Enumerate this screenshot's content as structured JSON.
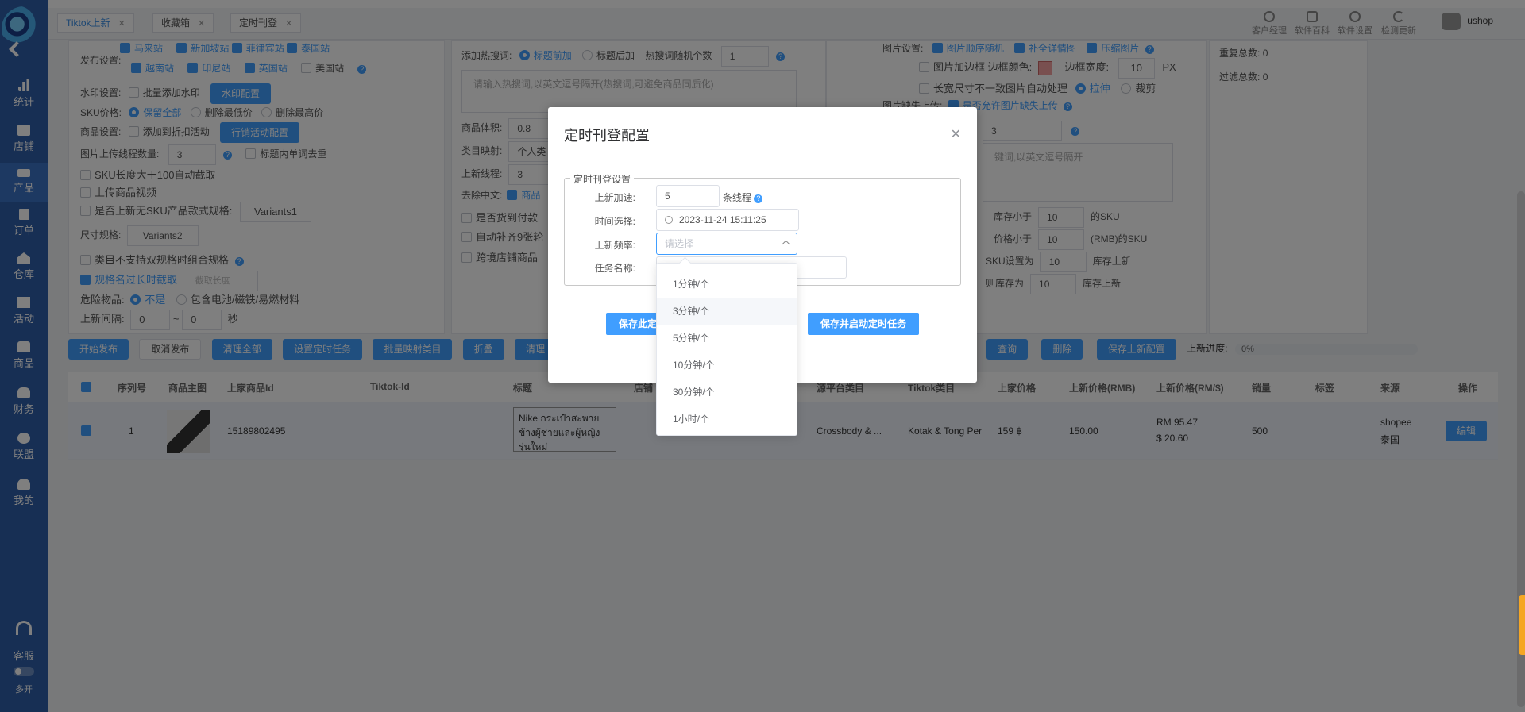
{
  "sidebar": {
    "items": [
      {
        "label": "统计",
        "icon": "bar-chart-icon"
      },
      {
        "label": "店铺",
        "icon": "store-icon"
      },
      {
        "label": "产品",
        "icon": "product-icon"
      },
      {
        "label": "订单",
        "icon": "order-icon"
      },
      {
        "label": "仓库",
        "icon": "warehouse-icon"
      },
      {
        "label": "活动",
        "icon": "gift-icon"
      },
      {
        "label": "商品",
        "icon": "goods-icon"
      },
      {
        "label": "财务",
        "icon": "finance-icon"
      },
      {
        "label": "联盟",
        "icon": "alliance-icon"
      },
      {
        "label": "我的",
        "icon": "user-icon"
      }
    ],
    "service_label": "客服",
    "multi_label": "多开"
  },
  "tabs": [
    {
      "label": "Tiktok上新"
    },
    {
      "label": "收藏箱"
    },
    {
      "label": "定时刊登"
    }
  ],
  "toolbar": {
    "items": [
      {
        "label": "客户经理",
        "icon": "person-icon"
      },
      {
        "label": "软件百科",
        "icon": "book-icon"
      },
      {
        "label": "软件设置",
        "icon": "gear-icon"
      },
      {
        "label": "检测更新",
        "icon": "refresh-icon"
      }
    ],
    "username": "ushop"
  },
  "settings": {
    "publish_label": "发布设置:",
    "sites": [
      "马来站",
      "新加坡站",
      "菲律宾站",
      "泰国站",
      "越南站",
      "印尼站",
      "英国站",
      "美国站"
    ],
    "watermark_label": "水印设置:",
    "watermark_batch": "批量添加水印",
    "watermark_btn": "水印配置",
    "sku_price_label": "SKU价格:",
    "sku_keep_all": "保留全部",
    "sku_del_min": "删除最低价",
    "sku_del_max": "删除最高价",
    "goods_label": "商品设置:",
    "goods_discount": "添加到折扣活动",
    "promo_btn": "行销活动配置",
    "img_threads_label": "图片上传线程数量:",
    "img_threads_value": "3",
    "title_dedup": "标题内单词去重",
    "sku_len": "SKU长度大于100自动截取",
    "upload_video": "上传商品视频",
    "no_sku_label": "是否上新无SKU产品款式规格:",
    "no_sku_value": "Variants1",
    "size_label": "尺寸规格:",
    "size_value": "Variants2",
    "cat_combo": "类目不支持双规格时组合规格",
    "spec_truncate": "规格名过长时截取",
    "spec_truncate_placeholder": "截取长度",
    "danger_label": "危险物品:",
    "danger_no": "不是",
    "danger_yes": "包含电池/磁铁/易燃材料",
    "interval_label": "上新间隔:",
    "interval_from": "0",
    "interval_to": "0",
    "interval_unit": "秒",
    "hot_label": "添加热搜词:",
    "hot_front": "标题前加",
    "hot_back": "标题后加",
    "hot_count_label": "热搜词随机个数",
    "hot_count_value": "1",
    "hot_placeholder": "请输入热搜词,以英文逗号隔开(热搜词,可避免商品同质化)",
    "volume_label": "商品体积:",
    "volume_value": "0.8",
    "cat_map_label": "类目映射:",
    "cat_map_value": "个人类",
    "threads_label": "上新线程:",
    "threads_value": "3",
    "remove_cn_label": "去除中文:",
    "remove_cn_value": "商品",
    "cod_label": "是否货到付款",
    "auto_fill_label": "自动补齐9张轮",
    "cross_label": "跨境店铺商品",
    "img_settings_label": "图片设置:",
    "img_random": "图片顺序随机",
    "img_detail": "补全详情图",
    "img_compress": "压缩图片",
    "img_border": "图片加边框 边框颜色:",
    "border_width_label": "边框宽度:",
    "border_width_value": "10",
    "border_width_unit": "PX",
    "aspect_label": "长宽尺寸不一致图片自动处理",
    "aspect_stretch": "拉伸",
    "aspect_crop": "裁剪",
    "missing_label": "图片缺失上传:",
    "missing_value": "是否允许图片缺失上传",
    "select_value": "3",
    "keyword_placeholder": "键词,以英文逗号隔开",
    "stock_lt_label": "库存小于",
    "stock_lt_value": "10",
    "stock_lt_unit": "的SKU",
    "price_lt_label": "价格小于",
    "price_lt_value": "10",
    "price_lt_unit": "(RMB)的SKU",
    "sku_set_label": "SKU设置为",
    "sku_set_value": "10",
    "sku_set_unit": "库存上新",
    "stock_as_label": "则库存为",
    "stock_as_value": "10",
    "stock_as_unit": "库存上新",
    "dup_total_label": "重复总数:",
    "dup_total_value": "0",
    "filter_total_label": "过滤总数:",
    "filter_total_value": "0"
  },
  "actions": {
    "start": "开始发布",
    "cancel": "取消发布",
    "clear_all": "清理全部",
    "set_timer": "设置定时任务",
    "batch_map": "批量映射类目",
    "collapse": "折叠",
    "clear": "清理",
    "query": "查询",
    "delete": "删除",
    "save_config": "保存上新配置",
    "progress_label": "上新进度:",
    "progress_value": "0%"
  },
  "table": {
    "headers": [
      "序列号",
      "商品主图",
      "上家商品Id",
      "Tiktok-Id",
      "标题",
      "店铺",
      "源平台类目",
      "Tiktok类目",
      "上家价格",
      "上新价格(RMB)",
      "上新价格(RM/$)",
      "销量",
      "标签",
      "来源",
      "操作"
    ],
    "rows": [
      {
        "index": "1",
        "product_id": "15189802495",
        "title": "Nike กระเป๋าสะพายข้างผู้ชายและผู้หญิงรุ่นใหม่",
        "src_category": "Crossbody & ...",
        "tiktok_category": "Kotak & Tong Per",
        "src_price": "159 ฿",
        "price_rmb": "150.00",
        "price_rm": "RM 95.47",
        "price_usd": "$ 20.60",
        "sales": "500",
        "source": "shopee",
        "region": "泰国",
        "edit": "编辑"
      }
    ]
  },
  "modal": {
    "title": "定时刊登配置",
    "legend": "定时刊登设置",
    "speed_label": "上新加速:",
    "speed_value": "5",
    "speed_unit": "条线程",
    "time_label": "时间选择:",
    "time_value": "2023-11-24 15:11:25",
    "freq_label": "上新频率:",
    "freq_placeholder": "请选择",
    "task_label": "任务名称:",
    "save_btn": "保存此定",
    "save_start_btn": "保存并启动定时任务",
    "freq_options": [
      "1分钟/个",
      "3分钟/个",
      "5分钟/个",
      "10分钟/个",
      "30分钟/个",
      "1小时/个"
    ]
  },
  "colors": {
    "sidebar": "#2f5fa8",
    "accent": "#409eff",
    "overlay": "rgba(0,0,0,0.5)"
  }
}
